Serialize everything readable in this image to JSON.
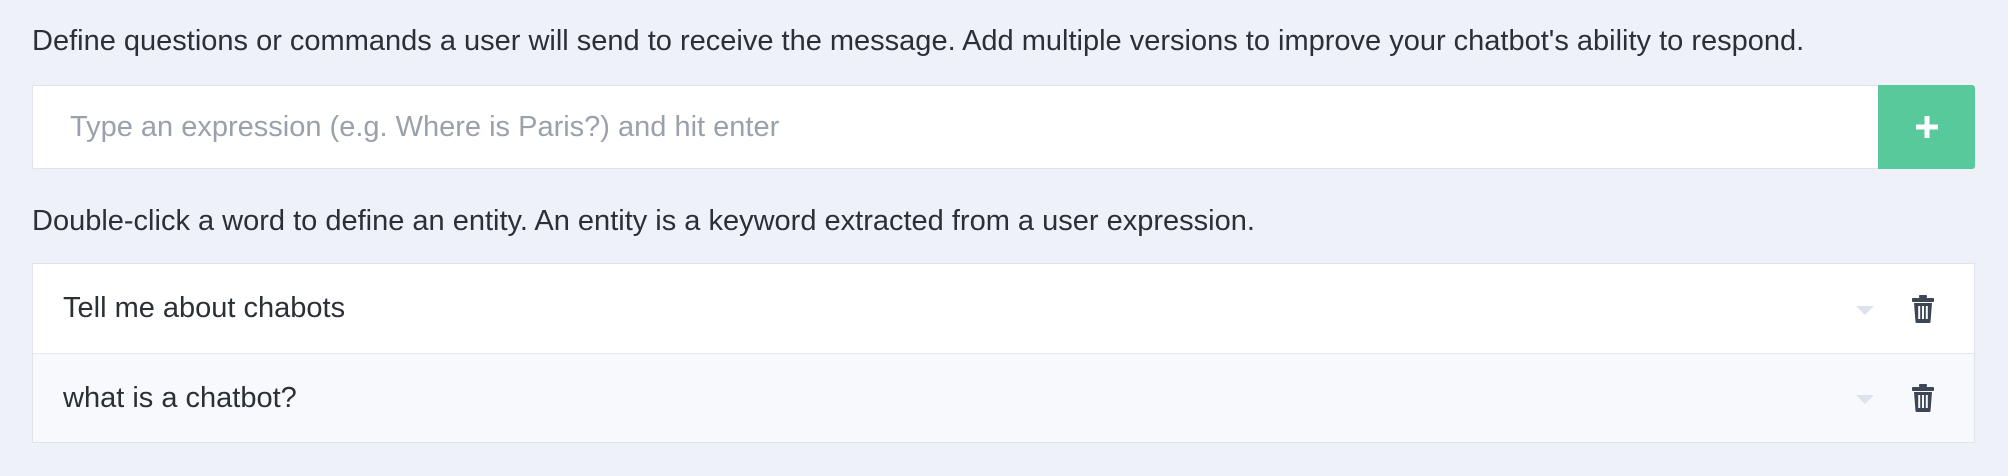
{
  "instructions": {
    "top": "Define questions or commands a user will send to receive the message. Add multiple versions to improve your chatbot's ability to respond.",
    "entity": "Double-click a word to define an entity. An entity is a keyword extracted from a user expression."
  },
  "expression_input": {
    "placeholder": "Type an expression (e.g. Where is Paris?) and hit enter",
    "value": ""
  },
  "add_button": {
    "icon": "plus-icon",
    "color": "#58c99b"
  },
  "expressions": [
    {
      "text": "Tell me about chabots"
    },
    {
      "text": "what is a chatbot?"
    }
  ],
  "icons": {
    "dropdown": "caret-down-icon",
    "delete": "trash-icon"
  }
}
